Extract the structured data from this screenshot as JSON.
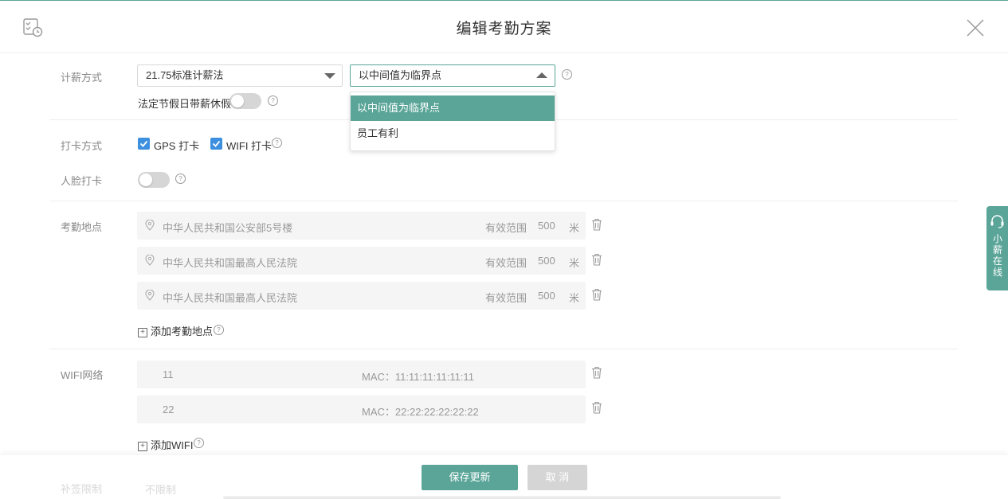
{
  "dialog": {
    "title": "编辑考勤方案"
  },
  "salary": {
    "label": "计薪方式",
    "method_value": "21.75标准计薪法",
    "threshold_value": "以中间值为临界点",
    "holiday_label": "法定节假日带薪休假",
    "holiday_on": false,
    "options": [
      "以中间值为临界点",
      "员工有利"
    ]
  },
  "punch": {
    "label": "打卡方式",
    "gps_label": "GPS 打卡",
    "wifi_label": "WIFI 打卡",
    "gps_checked": true,
    "wifi_checked": true
  },
  "face": {
    "label": "人脸打卡",
    "on": false
  },
  "locations": {
    "label": "考勤地点",
    "range_label": "有效范围",
    "unit": "米",
    "items": [
      {
        "address": "中华人民共和国公安部5号楼",
        "range": "500"
      },
      {
        "address": "中华人民共和国最高人民法院",
        "range": "500"
      },
      {
        "address": "中华人民共和国最高人民法院",
        "range": "500"
      }
    ],
    "add_label": "添加考勤地点"
  },
  "wifi": {
    "label": "WIFI网络",
    "items": [
      {
        "name": "11",
        "mac": "MAC：11:11:11:11:11:11"
      },
      {
        "name": "22",
        "mac": "MAC：22:22:22:22:22:22"
      }
    ],
    "add_label": "添加WIFI"
  },
  "hidden_row": {
    "label": "补签限制",
    "value": "不限制"
  },
  "footer": {
    "save_label": "保存更新",
    "cancel_label": "取 消"
  },
  "side_tab": {
    "label": "小薪在线"
  },
  "colors": {
    "accent": "#5aa598",
    "checkbox": "#3d8fe0"
  }
}
